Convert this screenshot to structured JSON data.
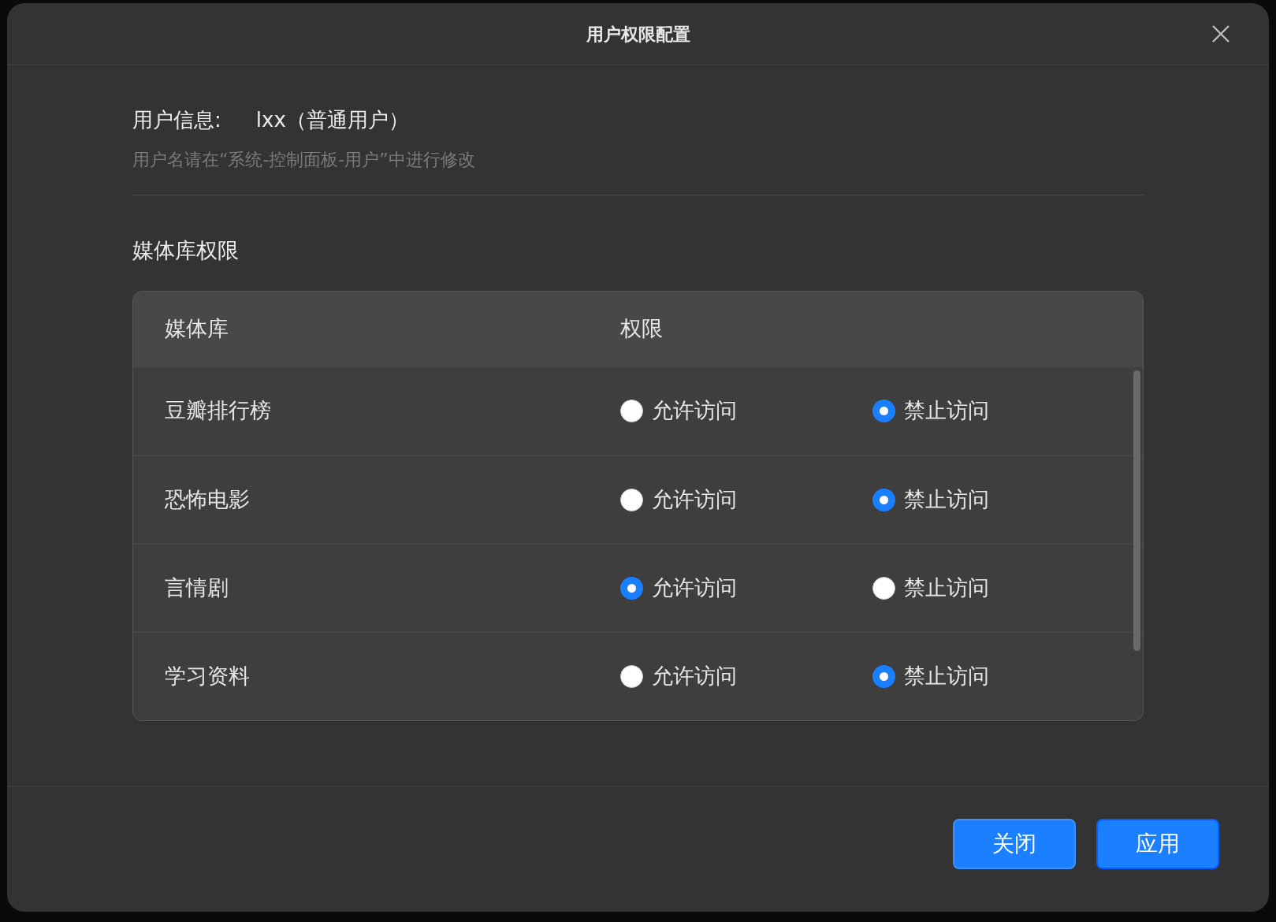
{
  "dialog": {
    "title": "用户权限配置",
    "user_info": {
      "label": "用户信息:",
      "value": "lxx（普通用户）",
      "hint": "用户名请在“系统-控制面板-用户”中进行修改"
    },
    "section_title": "媒体库权限",
    "table": {
      "columns": [
        "媒体库",
        "权限"
      ],
      "rows": [
        {
          "name": "豆瓣排行榜",
          "options": [
            {
              "label": "允许访问",
              "selected": false
            },
            {
              "label": "禁止访问",
              "selected": true
            }
          ]
        },
        {
          "name": "恐怖电影",
          "options": [
            {
              "label": "允许访问",
              "selected": false
            },
            {
              "label": "禁止访问",
              "selected": true
            }
          ]
        },
        {
          "name": "言情剧",
          "options": [
            {
              "label": "允许访问",
              "selected": true
            },
            {
              "label": "禁止访问",
              "selected": false
            }
          ]
        },
        {
          "name": "学习资料",
          "options": [
            {
              "label": "允许访问",
              "selected": false
            },
            {
              "label": "禁止访问",
              "selected": true
            }
          ]
        }
      ]
    },
    "buttons": [
      {
        "label": "关闭",
        "kind": "secondary"
      },
      {
        "label": "应用",
        "kind": "primary"
      }
    ]
  }
}
